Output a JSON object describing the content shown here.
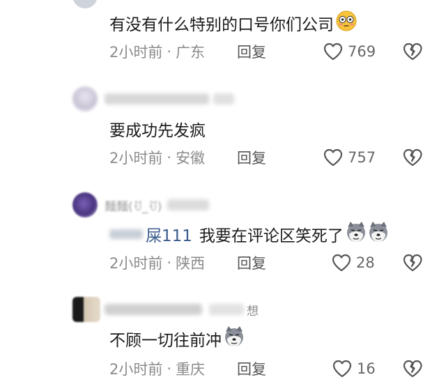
{
  "comments": [
    {
      "text": "有没有什么特别的口号你们公司",
      "time": "2小时前",
      "location": "广东",
      "reply_label": "回复",
      "likes": "769",
      "emoji": "flushed-face"
    },
    {
      "text": "要成功先发疯",
      "time": "2小时前",
      "location": "安徽",
      "reply_label": "回复",
      "likes": "757"
    },
    {
      "username_fragment": "麵麵(ꀀ_ꀀ)",
      "mention": "屎111",
      "text": "我要在评论区笑死了",
      "time": "2小时前",
      "location": "陕西",
      "reply_label": "回复",
      "likes": "28",
      "emoji": "husky-doge x2"
    },
    {
      "username_fragment": "想",
      "text": "不顾一切往前冲",
      "time": "2小时前",
      "location": "重庆",
      "reply_label": "回复",
      "likes": "16",
      "emoji": "husky-doge"
    }
  ],
  "colors": {
    "meta_text": "#8a8a8a",
    "mention": "#3a5a8c",
    "icon_stroke": "#555555"
  }
}
